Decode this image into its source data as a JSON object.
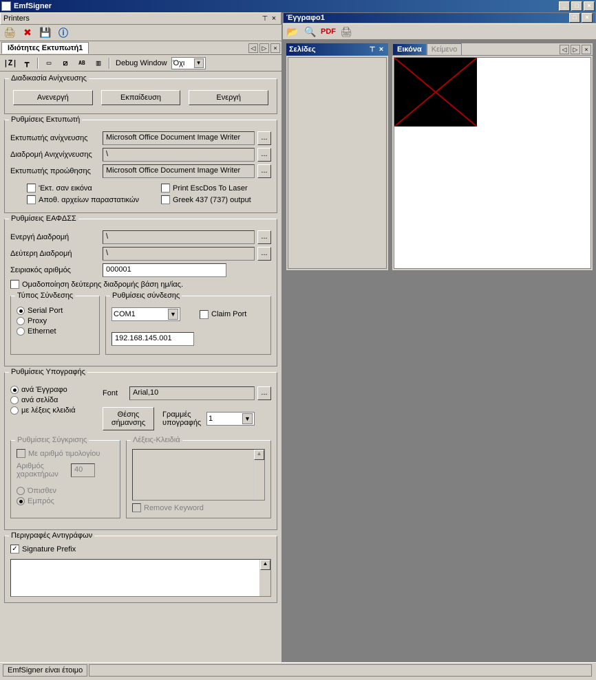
{
  "window": {
    "title": "EmfSigner"
  },
  "printersPanel": {
    "title": "Printers"
  },
  "toolbar1": {
    "printer_icon": "printer-icon",
    "delete_icon": "delete-icon",
    "save_icon": "save-icon",
    "info_icon": "info-icon"
  },
  "propertiesTab": {
    "label": "Ιδιότητες Εκτυπωτή1"
  },
  "secondaryToolbar": {
    "debugLabel": "Debug Window",
    "debugValue": "Όχι"
  },
  "detection": {
    "groupTitle": "Διαδικασία Ανίχνευσης",
    "btnInactive": "Ανενεργή",
    "btnTraining": "Εκπαίδευση",
    "btnActive": "Ενεργή"
  },
  "printerSettings": {
    "groupTitle": "Ρυθμίσεις Εκτυπωτή",
    "lblDetectPrinter": "Εκτυπωτής ανίχνευσης",
    "valDetectPrinter": "Microsoft Office Document Image Writer",
    "lblDetectPath": "Διαδρομή Ανιχνίχνευσης",
    "valDetectPath": "\\",
    "lblFwdPrinter": "Εκτυπωτής προώθησης",
    "valFwdPrinter": "Microsoft Office Document Image Writer",
    "chkAsImage": "'Εκτ. σαν εικόνα",
    "chkPrintEscDos": "Print EscDos To Laser",
    "chkStoreFiles": "Αποθ. αρχείων παραστατικών",
    "chkGreek437": "Greek 437 (737) output"
  },
  "eafdss": {
    "groupTitle": "Ρυθμίσεις ΕΑΦΔΣΣ",
    "lblActivePath": "Ενεργή Διαδρομή",
    "valActivePath": "\\",
    "lblSecondPath": "Δεύτερη Διαδρομή",
    "valSecondPath": "\\",
    "lblSerial": "Σειριακός αριθμός",
    "valSerial": "000001",
    "chkGroupSecond": "Ομαδοποίηση δεύτερης διαδρομής βάση ημ/ίας.",
    "connType": {
      "groupTitle": "Τύπος Σύνδεσης",
      "optSerial": "Serial Port",
      "optProxy": "Proxy",
      "optEthernet": "Ethernet"
    },
    "connSettings": {
      "groupTitle": "Ρυθμίσεις σύνδεσης",
      "comPort": "COM1",
      "chkClaimPort": "Claim Port",
      "ipAddress": "192.168.145.001"
    }
  },
  "signature": {
    "groupTitle": "Ρυθμίσεις Υπογραφής",
    "optPerDoc": "ανά Έγγραφο",
    "optPerPage": "ανά σελίδα",
    "optKeywords": "με λέξεις κλειδιά",
    "lblFont": "Font",
    "valFont": "Arial,10",
    "btnMarkPos": "Θέσης σήμανσης",
    "lblSigLines": "Γραμμές υπογραφής",
    "valSigLines": "1",
    "compare": {
      "groupTitle": "Ρυθμίσεις Σύγκρισης",
      "chkWithInvoice": "Με αριθμό τιμολογίου",
      "lblCharCount": "Αριθμός χαρακτήρων",
      "valCharCount": "40",
      "optBehind": "Όπισθεν",
      "optFront": "Εμπρός"
    },
    "keywords": {
      "groupTitle": "Λέξεις-Κλειδιά",
      "chkRemove": "Remove Keyword"
    }
  },
  "copies": {
    "groupTitle": "Περιγραφές Αντιγράφων",
    "chkPrefix": "Signature Prefix"
  },
  "docWindow": {
    "title": "Έγγραφο1",
    "pagesTitle": "Σελίδες",
    "tabImage": "Εικόνα",
    "tabText": "Κείμενο"
  },
  "status": {
    "text": "EmfSigner είναι έτοιμο"
  }
}
